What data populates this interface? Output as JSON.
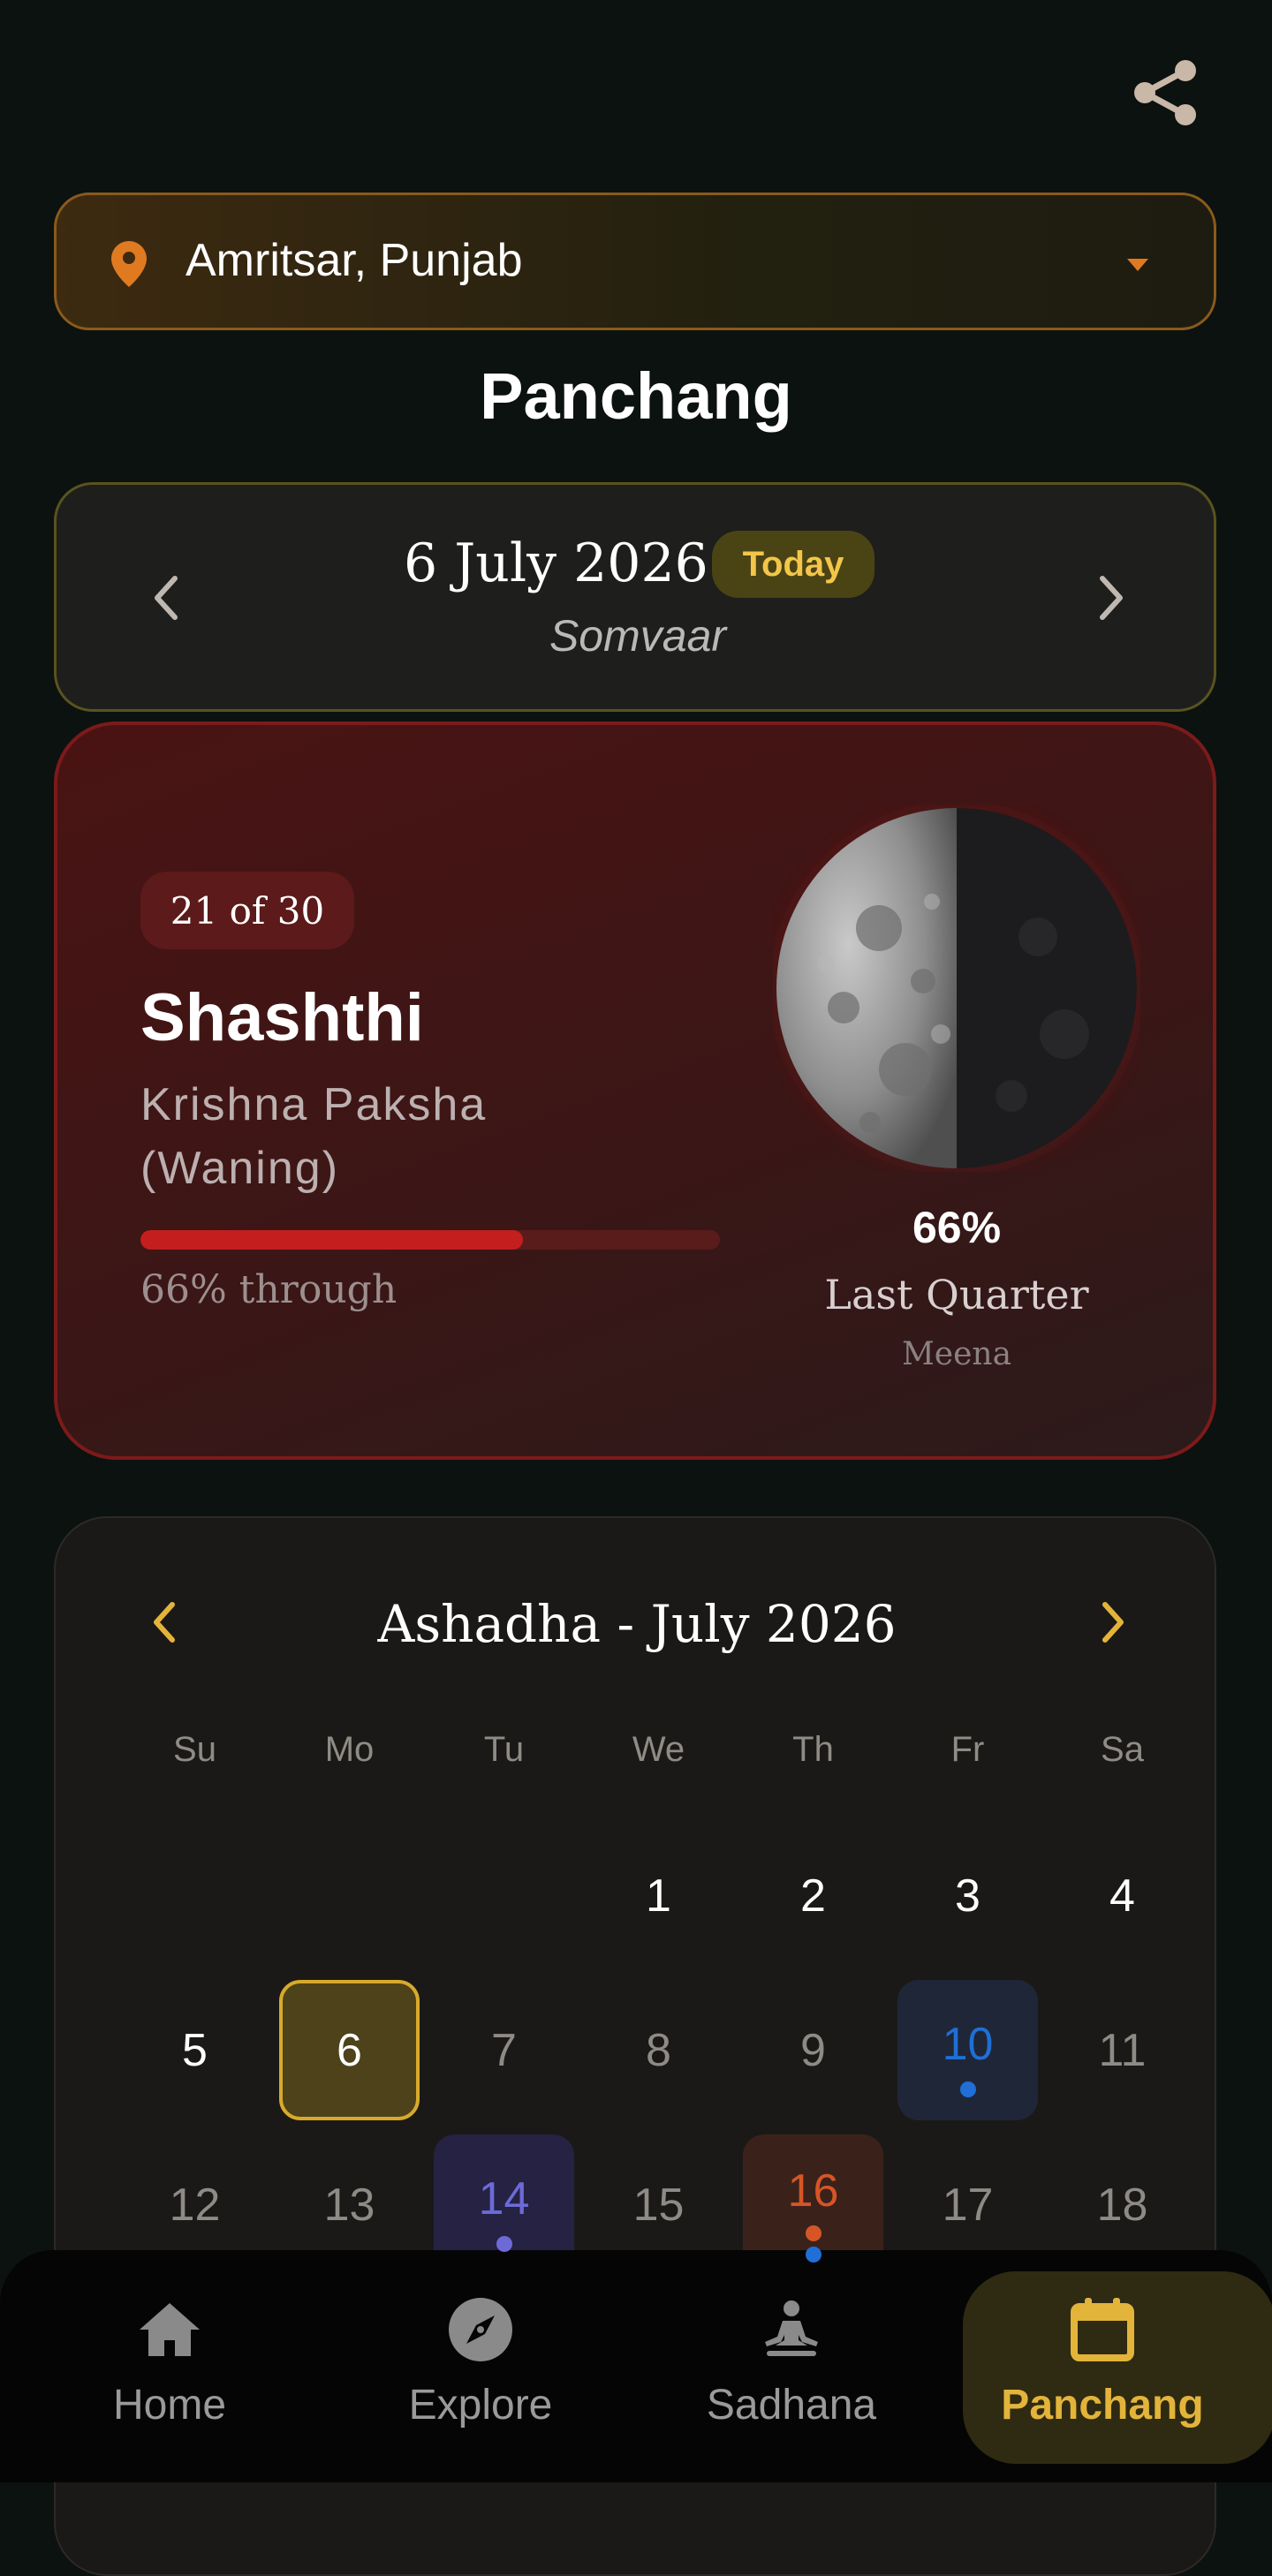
{
  "location": {
    "city": "Amritsar, Punjab"
  },
  "page_title": "Panchang",
  "date_nav": {
    "date": "6 July 2026",
    "today_badge": "Today",
    "vaar": "Somvaar"
  },
  "tithi": {
    "count": "21 of 30",
    "name": "Shashthi",
    "paksha": "Krishna Paksha (Waning)",
    "progress_fraction": 0.66,
    "progress_text": "66% through",
    "moon_illumination": "66%",
    "moon_phase": "Last Quarter",
    "rashi": "Meena"
  },
  "calendar": {
    "month_title": "Ashadha - July 2026",
    "weekdays": [
      "Su",
      "Mo",
      "Tu",
      "We",
      "Th",
      "Fr",
      "Sa"
    ],
    "days": [
      {
        "n": ""
      },
      {
        "n": ""
      },
      {
        "n": ""
      },
      {
        "n": "1",
        "tone": "bright"
      },
      {
        "n": "2",
        "tone": "bright"
      },
      {
        "n": "3",
        "tone": "bright"
      },
      {
        "n": "4",
        "tone": "bright"
      },
      {
        "n": "5",
        "tone": "bright"
      },
      {
        "n": "6",
        "tone": "today"
      },
      {
        "n": "7"
      },
      {
        "n": "8"
      },
      {
        "n": "9"
      },
      {
        "n": "10",
        "tone": "blue",
        "dots": [
          "#1f6fd6"
        ]
      },
      {
        "n": "11"
      },
      {
        "n": "12"
      },
      {
        "n": "13"
      },
      {
        "n": "14",
        "tone": "indigo",
        "dots": [
          "#6d6ad8"
        ]
      },
      {
        "n": "15"
      },
      {
        "n": "16",
        "tone": "orange",
        "dots": [
          "#d65526",
          "#1f6fd6"
        ]
      },
      {
        "n": "17"
      },
      {
        "n": "18"
      }
    ]
  },
  "bottom_nav": [
    {
      "label": "Home",
      "icon": "home-icon"
    },
    {
      "label": "Explore",
      "icon": "compass-icon"
    },
    {
      "label": "Sadhana",
      "icon": "meditation-icon"
    },
    {
      "label": "Panchang",
      "icon": "calendar-icon",
      "active": true
    }
  ],
  "colors": {
    "accent": "#e3b43a",
    "tithi_red": "#c41e1e",
    "pin_orange": "#e07a20"
  }
}
